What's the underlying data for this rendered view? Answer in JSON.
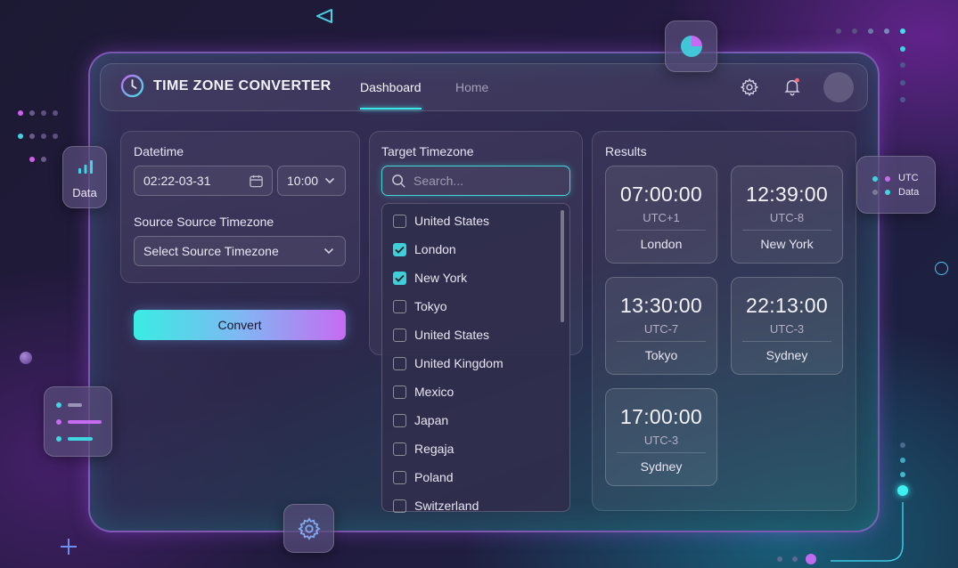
{
  "header": {
    "app_title": "TIME ZONE CONVERTER",
    "nav": [
      "Dashboard",
      "Home"
    ],
    "active_nav": "Dashboard",
    "icons": [
      "clock-logo-icon",
      "gear-icon",
      "bell-icon",
      "avatar"
    ]
  },
  "source_panel": {
    "datetime_label": "Datetime",
    "date_value": "02:22-03-31",
    "time_value": "10:00",
    "source_label": "Source Source Timezone",
    "source_placeholder": "Select Source Timezone",
    "convert_label": "Convert"
  },
  "target_panel": {
    "label": "Target Timezone",
    "search_placeholder": "Search...",
    "options": [
      {
        "label": "United States",
        "checked": false
      },
      {
        "label": "London",
        "checked": true
      },
      {
        "label": "New York",
        "checked": true
      },
      {
        "label": "Tokyo",
        "checked": false
      },
      {
        "label": "United States",
        "checked": false
      },
      {
        "label": "United Kingdom",
        "checked": false
      },
      {
        "label": "Mexico",
        "checked": false
      },
      {
        "label": "Japan",
        "checked": false
      },
      {
        "label": "Regaja",
        "checked": false
      },
      {
        "label": "Poland",
        "checked": false
      },
      {
        "label": "Switzerland",
        "checked": false
      }
    ]
  },
  "results": {
    "label": "Results",
    "cards": [
      {
        "time": "07:00:00",
        "offset": "UTC+1",
        "city": "London"
      },
      {
        "time": "12:39:00",
        "offset": "UTC-8",
        "city": "New York"
      },
      {
        "time": "13:30:00",
        "offset": "UTC-7",
        "city": "Tokyo"
      },
      {
        "time": "22:13:00",
        "offset": "UTC-3",
        "city": "Sydney"
      },
      {
        "time": "17:00:00",
        "offset": "UTC-3",
        "city": "Sydney"
      }
    ]
  },
  "floating": {
    "data_chip_label": "Data",
    "legend_items": [
      "UTC",
      "Data"
    ]
  },
  "colors": {
    "accent_cyan": "#3ee6e8",
    "accent_purple": "#c66bf2",
    "brand_border": "#be78ff"
  }
}
